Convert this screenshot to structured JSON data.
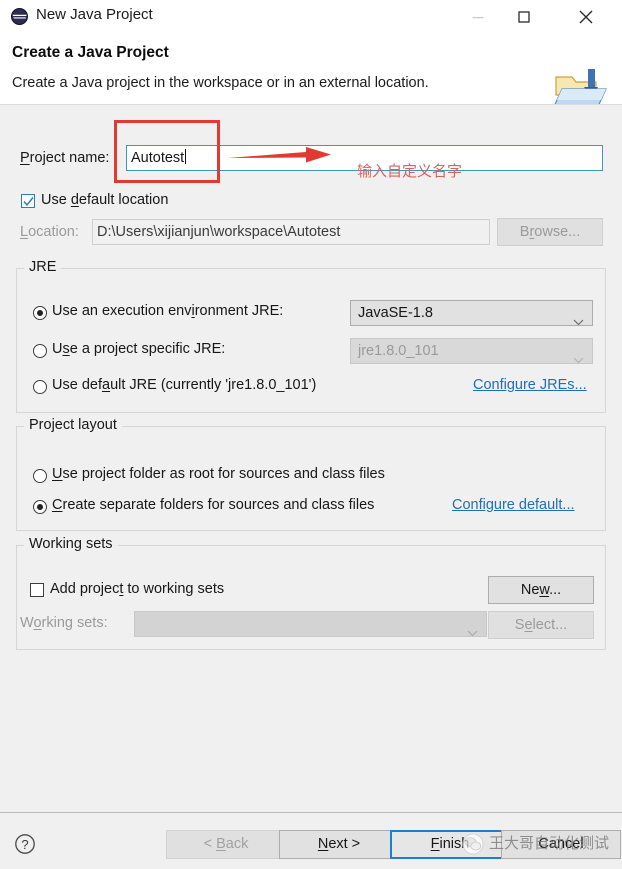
{
  "window": {
    "title": "New Java Project",
    "icon": "eclipse-icon",
    "controls": {
      "minimize": "minimize-icon",
      "maximize": "maximize-icon",
      "close": "close-icon"
    }
  },
  "header": {
    "title": "Create a Java Project",
    "description": "Create a Java project in the workspace or in an external location.",
    "icon": "new-java-project-folder-icon"
  },
  "form": {
    "project_name_label": "Project name:",
    "project_name_value": "Autotest",
    "use_default_location_label": "Use default location",
    "use_default_location_checked": true,
    "location_label": "Location:",
    "location_value": "D:\\Users\\xijianjun\\workspace\\Autotest",
    "browse_label": "Browse..."
  },
  "jre": {
    "group_title": "JRE",
    "option_execution_env": "Use an execution environment JRE:",
    "option_project_specific": "Use a project specific JRE:",
    "option_default": "Use default JRE (currently 'jre1.8.0_101')",
    "selected": "execution_env",
    "execution_env_value": "JavaSE-1.8",
    "project_specific_value": "jre1.8.0_101",
    "configure_link": "Configure JREs..."
  },
  "project_layout": {
    "group_title": "Project layout",
    "option_project_folder": "Use project folder as root for sources and class files",
    "option_separate_folders": "Create separate folders for sources and class files",
    "selected": "separate_folders",
    "configure_link": "Configure default..."
  },
  "working_sets": {
    "group_title": "Working sets",
    "add_checkbox_label": "Add project to working sets",
    "add_checkbox_checked": false,
    "working_sets_label": "Working sets:",
    "working_sets_value": "",
    "new_label": "New...",
    "select_label": "Select..."
  },
  "footer": {
    "help_icon": "help-icon",
    "back_label": "< Back",
    "back_enabled": false,
    "next_label": "Next >",
    "finish_label": "Finish",
    "cancel_label": "Cancel"
  },
  "annotation": {
    "text": "输入自定义名字",
    "color": "#e03a33"
  },
  "watermark": {
    "text": "王大哥自动化测试",
    "logo": "wechat-logo-icon"
  }
}
